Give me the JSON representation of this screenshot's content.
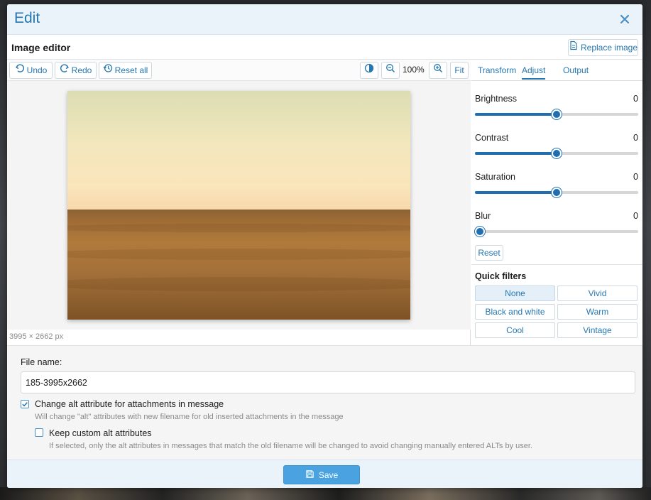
{
  "dialog": {
    "title": "Edit",
    "close_icon": "close-icon"
  },
  "editor": {
    "title": "Image editor",
    "replace_label": "Replace image"
  },
  "toolbar": {
    "undo_label": "Undo",
    "redo_label": "Redo",
    "reset_all_label": "Reset all",
    "zoom_level": "100%",
    "fit_label": "Fit"
  },
  "image": {
    "dimensions": "3995 × 2662 px"
  },
  "tabs": [
    {
      "label": "Transform"
    },
    {
      "label": "Adjust",
      "active": true
    },
    {
      "label": "Output"
    }
  ],
  "adjust": {
    "brightness": {
      "label": "Brightness",
      "value": "0",
      "fraction": 0.5
    },
    "contrast": {
      "label": "Contrast",
      "value": "0",
      "fraction": 0.5
    },
    "saturation": {
      "label": "Saturation",
      "value": "0",
      "fraction": 0.5
    },
    "blur": {
      "label": "Blur",
      "value": "0",
      "fraction": 0
    },
    "reset_label": "Reset"
  },
  "quick_filters": {
    "title": "Quick filters",
    "items": [
      "None",
      "Vivid",
      "Black and white",
      "Warm",
      "Cool",
      "Vintage"
    ],
    "selected": "None"
  },
  "file": {
    "label": "File name:",
    "value": "185-3995x2662"
  },
  "options": {
    "change_alt": {
      "label": "Change alt attribute for attachments in message",
      "hint": "Will change \"alt\" attributes with new filename for old inserted attachments in the message",
      "checked": true
    },
    "keep_custom": {
      "label": "Keep custom alt attributes",
      "hint": "If selected, only the alt attributes in messages that match the old filename will be changed to avoid changing manually entered ALTs by user.",
      "checked": false
    }
  },
  "footer": {
    "save_label": "Save"
  },
  "colors": {
    "accent": "#2577b1",
    "slider": "#1f6fb0",
    "save_button": "#4aa3e0"
  }
}
